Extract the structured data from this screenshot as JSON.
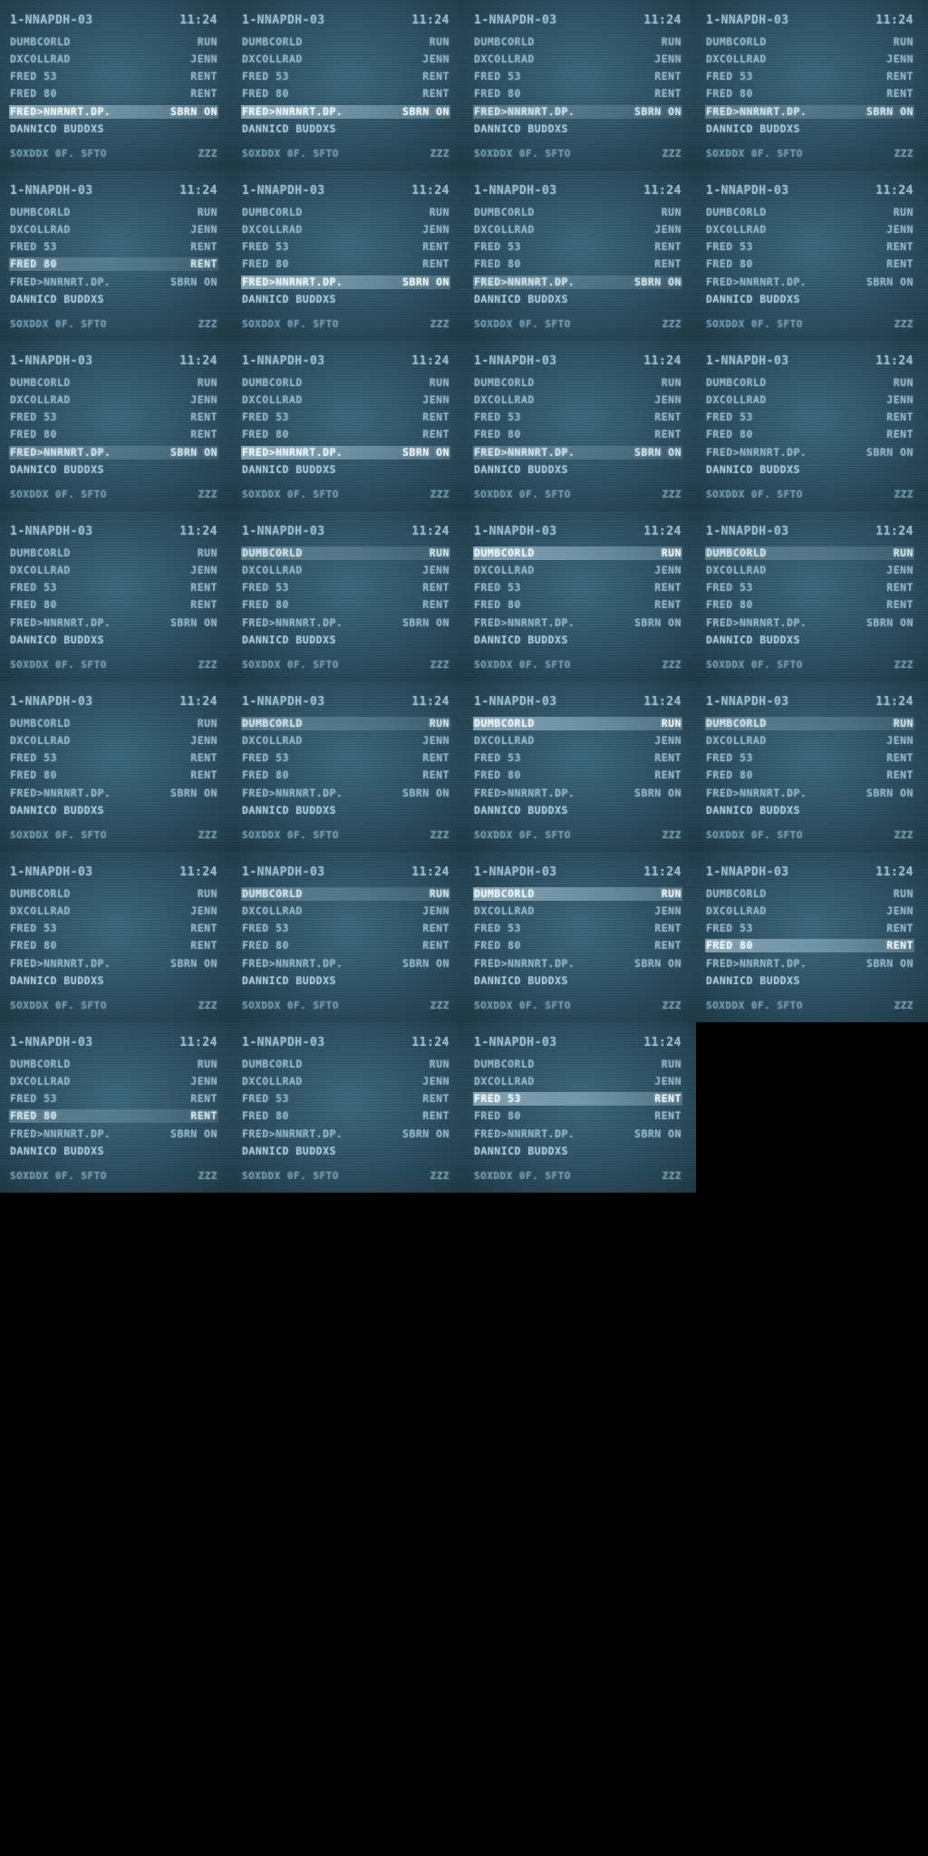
{
  "screen": {
    "header": {
      "title": "1-NNAPDH-03",
      "time": "11:24"
    },
    "rows": [
      {
        "label": "DUMBCORLD",
        "value": "RUN"
      },
      {
        "label": "DXCOLLRAD",
        "value": "JENN"
      },
      {
        "label": "FRED 53",
        "value": "RENT"
      },
      {
        "label": "FRED 80",
        "value": "RENT"
      },
      {
        "label": "FRED>NNRNRT.DP.",
        "value": "SBRN ON"
      },
      {
        "label": "DANNICD BUDDXS",
        "value": ""
      }
    ],
    "footer": {
      "label": "SOXDDX 0F. SFTO",
      "value": "ZZZ"
    }
  },
  "frames": [
    {
      "highlight": 4,
      "strength": "strong"
    },
    {
      "highlight": 4,
      "strength": "strong"
    },
    {
      "highlight": 4,
      "strength": "dim"
    },
    {
      "highlight": 4,
      "strength": "dim"
    },
    {
      "highlight": 3,
      "strength": "dim"
    },
    {
      "highlight": 4,
      "strength": "strong"
    },
    {
      "highlight": 4,
      "strength": "dim"
    },
    {
      "highlight": -1,
      "strength": "none"
    },
    {
      "highlight": 4,
      "strength": "dim"
    },
    {
      "highlight": 4,
      "strength": "strong"
    },
    {
      "highlight": 4,
      "strength": "dim"
    },
    {
      "highlight": -1,
      "strength": "none"
    },
    {
      "highlight": -1,
      "strength": "none"
    },
    {
      "highlight": 0,
      "strength": "dim"
    },
    {
      "highlight": 0,
      "strength": "strong"
    },
    {
      "highlight": 0,
      "strength": "dim"
    },
    {
      "highlight": -1,
      "strength": "none"
    },
    {
      "highlight": 0,
      "strength": "dim"
    },
    {
      "highlight": 0,
      "strength": "strong"
    },
    {
      "highlight": 0,
      "strength": "dim"
    },
    {
      "highlight": -1,
      "strength": "none"
    },
    {
      "highlight": 0,
      "strength": "dim"
    },
    {
      "highlight": 0,
      "strength": "strong"
    },
    {
      "highlight": 3,
      "strength": "strong"
    },
    {
      "highlight": 3,
      "strength": "dim"
    },
    {
      "highlight": -1,
      "strength": "none"
    },
    {
      "highlight": 2,
      "strength": "strong"
    }
  ]
}
